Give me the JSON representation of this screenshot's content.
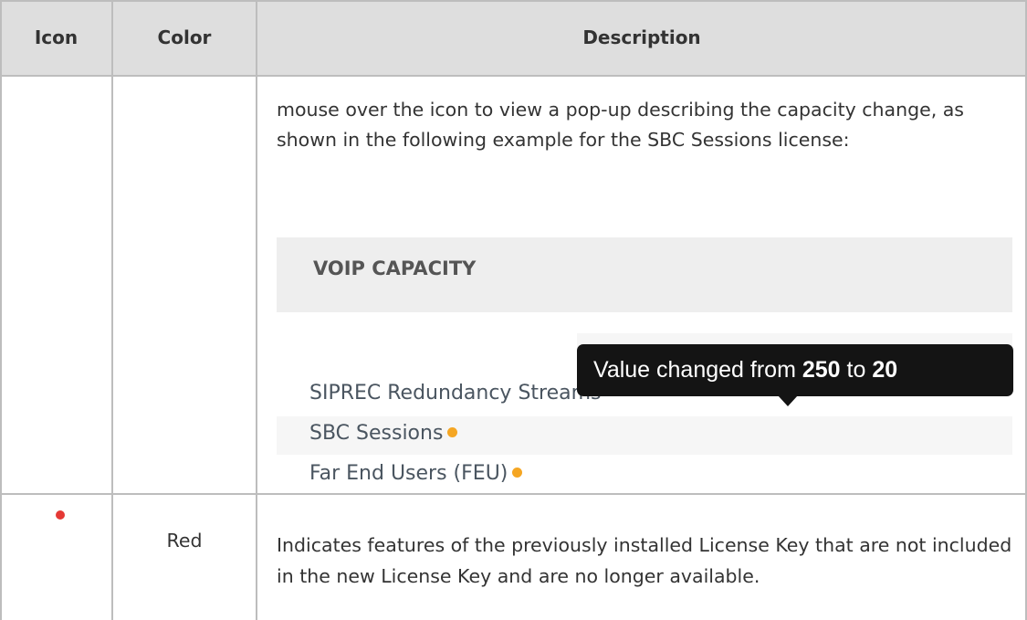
{
  "table": {
    "headers": {
      "icon": "Icon",
      "color": "Color",
      "description": "Description"
    },
    "row1": {
      "description_paragraph": "mouse over the icon to view a pop-up describing the capacity change, as shown in the following example for the SBC Sessions license:",
      "example": {
        "section_title": "VOIP CAPACITY",
        "features": [
          "SIPREC Redundancy Streams",
          "SBC Sessions",
          "Far End Users (FEU)"
        ],
        "tooltip": {
          "prefix": "Value changed from ",
          "from_value": "250",
          "middle": " to ",
          "to_value": "20"
        },
        "changed_dot_color": "#f5a623"
      }
    },
    "row2": {
      "icon_color": "#e53935",
      "color_label": "Red",
      "description": "Indicates features of the previously installed License Key that are not included in the new License Key and are no longer available."
    }
  }
}
